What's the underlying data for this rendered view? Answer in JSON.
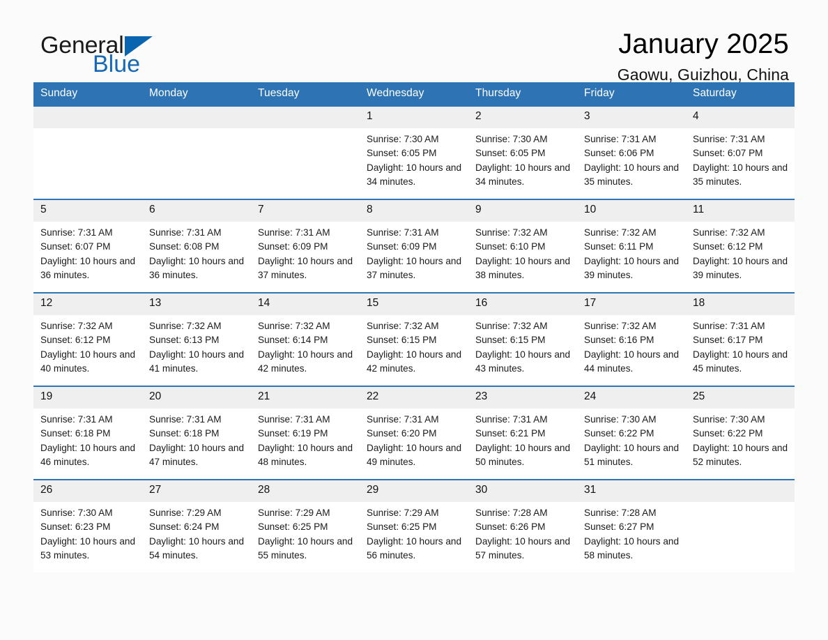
{
  "brand": {
    "word1": "General",
    "word2": "Blue",
    "triangle_color": "#0a65b0",
    "word2_color": "#1769b5"
  },
  "header": {
    "month_title": "January 2025",
    "location": "Gaowu, Guizhou, China"
  },
  "theme": {
    "header_blue": "#2e74b5",
    "date_band_gray": "#efefef",
    "page_background": "#fbfbfb"
  },
  "weekday_headers": [
    "Sunday",
    "Monday",
    "Tuesday",
    "Wednesday",
    "Thursday",
    "Friday",
    "Saturday"
  ],
  "labels": {
    "sunrise_prefix": "Sunrise:",
    "sunset_prefix": "Sunset:",
    "daylight_prefix": "Daylight:"
  },
  "weeks": [
    [
      {
        "day": "",
        "empty": true
      },
      {
        "day": "",
        "empty": true
      },
      {
        "day": "",
        "empty": true
      },
      {
        "day": "1",
        "sunrise": "Sunrise: 7:30 AM",
        "sunset": "Sunset: 6:05 PM",
        "daylight": "Daylight: 10 hours and 34 minutes."
      },
      {
        "day": "2",
        "sunrise": "Sunrise: 7:30 AM",
        "sunset": "Sunset: 6:05 PM",
        "daylight": "Daylight: 10 hours and 34 minutes."
      },
      {
        "day": "3",
        "sunrise": "Sunrise: 7:31 AM",
        "sunset": "Sunset: 6:06 PM",
        "daylight": "Daylight: 10 hours and 35 minutes."
      },
      {
        "day": "4",
        "sunrise": "Sunrise: 7:31 AM",
        "sunset": "Sunset: 6:07 PM",
        "daylight": "Daylight: 10 hours and 35 minutes."
      }
    ],
    [
      {
        "day": "5",
        "sunrise": "Sunrise: 7:31 AM",
        "sunset": "Sunset: 6:07 PM",
        "daylight": "Daylight: 10 hours and 36 minutes."
      },
      {
        "day": "6",
        "sunrise": "Sunrise: 7:31 AM",
        "sunset": "Sunset: 6:08 PM",
        "daylight": "Daylight: 10 hours and 36 minutes."
      },
      {
        "day": "7",
        "sunrise": "Sunrise: 7:31 AM",
        "sunset": "Sunset: 6:09 PM",
        "daylight": "Daylight: 10 hours and 37 minutes."
      },
      {
        "day": "8",
        "sunrise": "Sunrise: 7:31 AM",
        "sunset": "Sunset: 6:09 PM",
        "daylight": "Daylight: 10 hours and 37 minutes."
      },
      {
        "day": "9",
        "sunrise": "Sunrise: 7:32 AM",
        "sunset": "Sunset: 6:10 PM",
        "daylight": "Daylight: 10 hours and 38 minutes."
      },
      {
        "day": "10",
        "sunrise": "Sunrise: 7:32 AM",
        "sunset": "Sunset: 6:11 PM",
        "daylight": "Daylight: 10 hours and 39 minutes."
      },
      {
        "day": "11",
        "sunrise": "Sunrise: 7:32 AM",
        "sunset": "Sunset: 6:12 PM",
        "daylight": "Daylight: 10 hours and 39 minutes."
      }
    ],
    [
      {
        "day": "12",
        "sunrise": "Sunrise: 7:32 AM",
        "sunset": "Sunset: 6:12 PM",
        "daylight": "Daylight: 10 hours and 40 minutes."
      },
      {
        "day": "13",
        "sunrise": "Sunrise: 7:32 AM",
        "sunset": "Sunset: 6:13 PM",
        "daylight": "Daylight: 10 hours and 41 minutes."
      },
      {
        "day": "14",
        "sunrise": "Sunrise: 7:32 AM",
        "sunset": "Sunset: 6:14 PM",
        "daylight": "Daylight: 10 hours and 42 minutes."
      },
      {
        "day": "15",
        "sunrise": "Sunrise: 7:32 AM",
        "sunset": "Sunset: 6:15 PM",
        "daylight": "Daylight: 10 hours and 42 minutes."
      },
      {
        "day": "16",
        "sunrise": "Sunrise: 7:32 AM",
        "sunset": "Sunset: 6:15 PM",
        "daylight": "Daylight: 10 hours and 43 minutes."
      },
      {
        "day": "17",
        "sunrise": "Sunrise: 7:32 AM",
        "sunset": "Sunset: 6:16 PM",
        "daylight": "Daylight: 10 hours and 44 minutes."
      },
      {
        "day": "18",
        "sunrise": "Sunrise: 7:31 AM",
        "sunset": "Sunset: 6:17 PM",
        "daylight": "Daylight: 10 hours and 45 minutes."
      }
    ],
    [
      {
        "day": "19",
        "sunrise": "Sunrise: 7:31 AM",
        "sunset": "Sunset: 6:18 PM",
        "daylight": "Daylight: 10 hours and 46 minutes."
      },
      {
        "day": "20",
        "sunrise": "Sunrise: 7:31 AM",
        "sunset": "Sunset: 6:18 PM",
        "daylight": "Daylight: 10 hours and 47 minutes."
      },
      {
        "day": "21",
        "sunrise": "Sunrise: 7:31 AM",
        "sunset": "Sunset: 6:19 PM",
        "daylight": "Daylight: 10 hours and 48 minutes."
      },
      {
        "day": "22",
        "sunrise": "Sunrise: 7:31 AM",
        "sunset": "Sunset: 6:20 PM",
        "daylight": "Daylight: 10 hours and 49 minutes."
      },
      {
        "day": "23",
        "sunrise": "Sunrise: 7:31 AM",
        "sunset": "Sunset: 6:21 PM",
        "daylight": "Daylight: 10 hours and 50 minutes."
      },
      {
        "day": "24",
        "sunrise": "Sunrise: 7:30 AM",
        "sunset": "Sunset: 6:22 PM",
        "daylight": "Daylight: 10 hours and 51 minutes."
      },
      {
        "day": "25",
        "sunrise": "Sunrise: 7:30 AM",
        "sunset": "Sunset: 6:22 PM",
        "daylight": "Daylight: 10 hours and 52 minutes."
      }
    ],
    [
      {
        "day": "26",
        "sunrise": "Sunrise: 7:30 AM",
        "sunset": "Sunset: 6:23 PM",
        "daylight": "Daylight: 10 hours and 53 minutes."
      },
      {
        "day": "27",
        "sunrise": "Sunrise: 7:29 AM",
        "sunset": "Sunset: 6:24 PM",
        "daylight": "Daylight: 10 hours and 54 minutes."
      },
      {
        "day": "28",
        "sunrise": "Sunrise: 7:29 AM",
        "sunset": "Sunset: 6:25 PM",
        "daylight": "Daylight: 10 hours and 55 minutes."
      },
      {
        "day": "29",
        "sunrise": "Sunrise: 7:29 AM",
        "sunset": "Sunset: 6:25 PM",
        "daylight": "Daylight: 10 hours and 56 minutes."
      },
      {
        "day": "30",
        "sunrise": "Sunrise: 7:28 AM",
        "sunset": "Sunset: 6:26 PM",
        "daylight": "Daylight: 10 hours and 57 minutes."
      },
      {
        "day": "31",
        "sunrise": "Sunrise: 7:28 AM",
        "sunset": "Sunset: 6:27 PM",
        "daylight": "Daylight: 10 hours and 58 minutes."
      },
      {
        "day": "",
        "empty": true
      }
    ]
  ]
}
